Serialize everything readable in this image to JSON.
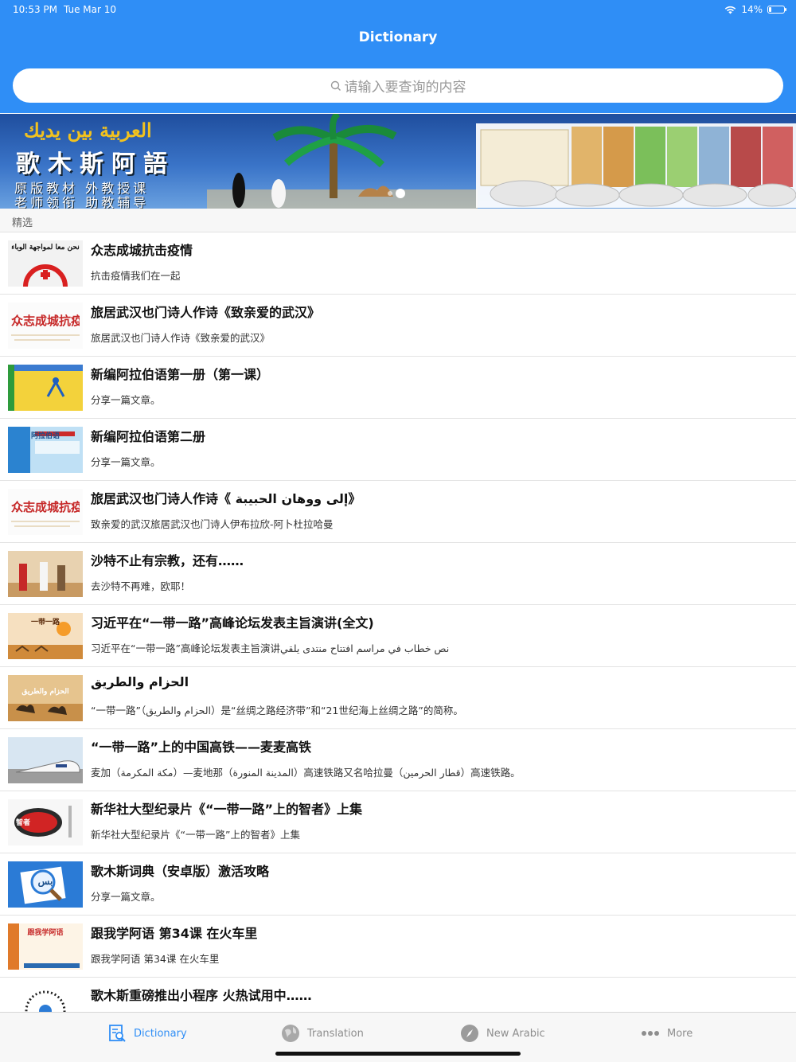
{
  "status_bar": {
    "time": "10:53 PM",
    "date": "Tue Mar 10",
    "battery_text": "14%",
    "battery_level": 0.14
  },
  "nav": {
    "title": "Dictionary"
  },
  "search": {
    "placeholder": "请输入要查询的内容"
  },
  "banner": {
    "arabic": "العربية بين يديك",
    "title": "歌木斯阿語",
    "line1": "原版教材 外教授课",
    "line2": "老师领衔 助教辅导"
  },
  "section": {
    "label": "精选"
  },
  "articles": [
    {
      "title": "众志成城抗击疫情",
      "subtitle": "抗击疫情我们在一起",
      "thumb": "red-cross-logo",
      "thumb_text": "نحن معا لمواجهة الوباء"
    },
    {
      "title": "旅居武汉也门诗人作诗《致亲爱的武汉》",
      "subtitle": "旅居武汉也门诗人作诗《致亲爱的武汉》",
      "thumb": "calligraphy-poster",
      "thumb_text": "众志成城抗疫情"
    },
    {
      "title": "新编阿拉伯语第一册（第一课）",
      "subtitle": "分享一篇文章。",
      "thumb": "yellow-textbook",
      "thumb_text": ""
    },
    {
      "title": "新编阿拉伯语第二册",
      "subtitle": "分享一篇文章。",
      "thumb": "blue-textbook",
      "thumb_text": "阿拉伯语"
    },
    {
      "title": "旅居武汉也门诗人作诗《 إلى ووهان الحبيبة》",
      "subtitle": "致亲爱的武汉旅居武汉也门诗人伊布拉欣-阿卜杜拉哈曼",
      "thumb": "calligraphy-poster",
      "thumb_text": "众志成城抗疫情"
    },
    {
      "title": "沙特不止有宗教，还有……",
      "subtitle": "去沙特不再难，欧耶！",
      "thumb": "desert-people",
      "thumb_text": ""
    },
    {
      "title": "习近平在“一带一路”高峰论坛发表主旨演讲(全文)",
      "subtitle": "习近平在“一带一路”高峰论坛发表主旨演讲نص خطاب في مراسم افتتاح منتدى يلقي",
      "thumb": "belt-road-poster",
      "thumb_text": "一带一路"
    },
    {
      "title": "الحزام والطريق",
      "subtitle": "“一带一路”（الحزام والطريق）是“丝绸之路经济带”和“21世纪海上丝绸之路”的简称。",
      "thumb": "camel-caravan",
      "thumb_text": "الحزام والطريق"
    },
    {
      "title": "“一带一路”上的中国高铁——麦麦高铁",
      "subtitle": "麦加（مكة المكرمة）—麦地那（المدينة المنورة）高速铁路又名哈拉曼（قطار الحرمين）高速铁路。",
      "thumb": "high-speed-train",
      "thumb_text": ""
    },
    {
      "title": "新华社大型纪录片《“一带一路”上的智者》上集",
      "subtitle": "新华社大型纪录片《“一带一路”上的智者》上集",
      "thumb": "wise-logo",
      "thumb_text": "智者"
    },
    {
      "title": "歌木斯词典（安卓版）激活攻略",
      "subtitle": "分享一篇文章。",
      "thumb": "dictionary-app-icon",
      "thumb_text": "بس"
    },
    {
      "title": "跟我学阿语 第34课 在火车里",
      "subtitle": "跟我学阿语 第34课  在火车里",
      "thumb": "lesson-poster",
      "thumb_text": "跟我学阿语"
    },
    {
      "title": "歌木斯重磅推出小程序 火热试用中……",
      "subtitle": "",
      "thumb": "qr-code",
      "thumb_text": ""
    }
  ],
  "tabs": [
    {
      "label": "Dictionary",
      "icon": "dictionary-icon",
      "active": true
    },
    {
      "label": "Translation",
      "icon": "globe-icon",
      "active": false
    },
    {
      "label": "New Arabic",
      "icon": "compass-icon",
      "active": false
    },
    {
      "label": "More",
      "icon": "more-dots-icon",
      "active": false
    }
  ],
  "colors": {
    "primary": "#2f8ef6",
    "tab_inactive": "#8e8e8e"
  }
}
